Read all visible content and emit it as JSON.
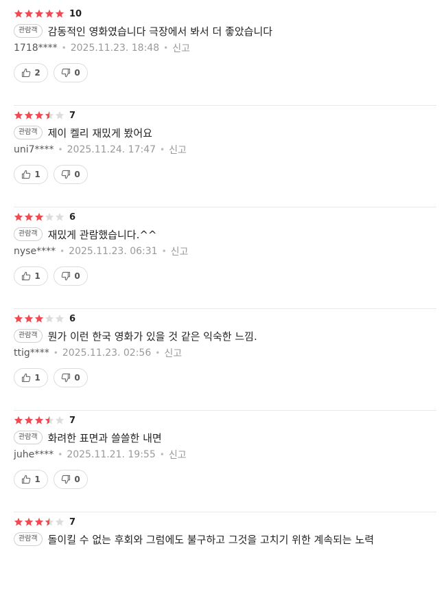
{
  "colors": {
    "star_filled": "#ee4b55",
    "star_empty": "#dddddd"
  },
  "icons": {
    "like": "thumb-up-icon",
    "dislike": "thumb-down-icon",
    "star": "star-icon"
  },
  "reviews": [
    {
      "stars": 5,
      "score": "10",
      "badge": "관람객",
      "text": "감동적인 영화였습니다 극장에서 봐서 더 좋았습니다",
      "user": "1718****",
      "date": "2025.11.23. 18:48",
      "report": "신고",
      "likes": "2",
      "dislikes": "0"
    },
    {
      "stars": 3.5,
      "score": "7",
      "badge": "관람객",
      "text": "제이 켈리 재밌게 봤어요",
      "user": "uni7****",
      "date": "2025.11.24. 17:47",
      "report": "신고",
      "likes": "1",
      "dislikes": "0"
    },
    {
      "stars": 3,
      "score": "6",
      "badge": "관람객",
      "text": "재밌게 관람했습니다.^^",
      "user": "nyse****",
      "date": "2025.11.23. 06:31",
      "report": "신고",
      "likes": "1",
      "dislikes": "0"
    },
    {
      "stars": 3,
      "score": "6",
      "badge": "관람객",
      "text": "뭔가 이런 한국 영화가 있을 것 같은 익숙한 느낌.",
      "user": "ttig****",
      "date": "2025.11.23. 02:56",
      "report": "신고",
      "likes": "1",
      "dislikes": "0"
    },
    {
      "stars": 3.5,
      "score": "7",
      "badge": "관람객",
      "text": "화려한 표면과 쓸쓸한 내면",
      "user": "juhe****",
      "date": "2025.11.21. 19:55",
      "report": "신고",
      "likes": "1",
      "dislikes": "0"
    },
    {
      "stars": 3.5,
      "score": "7",
      "badge": "관람객",
      "text": "돌이킬 수 없는 후회와 그럼에도 불구하고 그것을 고치기 위한 계속되는 노력"
    }
  ]
}
